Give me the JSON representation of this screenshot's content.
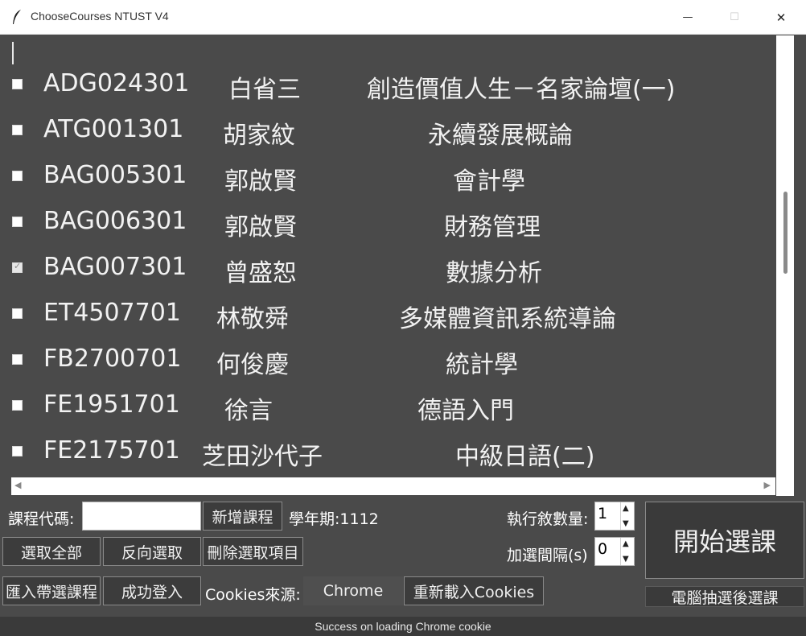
{
  "window": {
    "title": "ChooseCourses NTUST V4",
    "min_glyph": "—",
    "max_glyph": "☐",
    "close_glyph": "✕"
  },
  "courses": [
    {
      "code": "ADG024301",
      "teacher": "白省三",
      "name": "創造價值人生－名家論壇(一)",
      "checked": false
    },
    {
      "code": "ATG001301",
      "teacher": "胡家紋",
      "name": "永續發展概論",
      "checked": false
    },
    {
      "code": "BAG005301",
      "teacher": "郭啟賢",
      "name": "會計學",
      "checked": false
    },
    {
      "code": "BAG006301",
      "teacher": "郭啟賢",
      "name": "財務管理",
      "checked": false
    },
    {
      "code": "BAG007301",
      "teacher": "曾盛恕",
      "name": "數據分析",
      "checked": true
    },
    {
      "code": "ET4507701",
      "teacher": "林敬舜",
      "name": "多媒體資訊系統導論",
      "checked": false
    },
    {
      "code": "FB2700701",
      "teacher": "何俊慶",
      "name": "統計學",
      "checked": false
    },
    {
      "code": "FE1951701",
      "teacher": "徐言",
      "name": "德語入門",
      "checked": false
    },
    {
      "code": "FE2175701",
      "teacher": "芝田沙代子",
      "name": "中級日語(二)",
      "checked": false
    }
  ],
  "controls": {
    "course_code_label": "課程代碼:",
    "course_code_value": "",
    "add_course_button": "新增課程",
    "semester_label": "學年期:1112",
    "select_all_button": "選取全部",
    "invert_selection_button": "反向選取",
    "delete_selected_button": "刪除選取項目",
    "import_button": "匯入帶選課程",
    "login_success_button": "成功登入",
    "cookies_source_label": "Cookies來源:",
    "cookies_source_value": "Chrome",
    "reload_cookies_button": "重新載入Cookies",
    "threads_label": "執行敘數量:",
    "threads_value": "1",
    "interval_label": "加選間隔(s)",
    "interval_value": "0",
    "start_button": "開始選課",
    "mode_label": "電腦抽選後選課"
  },
  "status": {
    "text": "Success on loading Chrome cookie"
  },
  "scroll": {
    "vertical_position": 0.35,
    "vertical_visible_fraction": 0.18
  }
}
